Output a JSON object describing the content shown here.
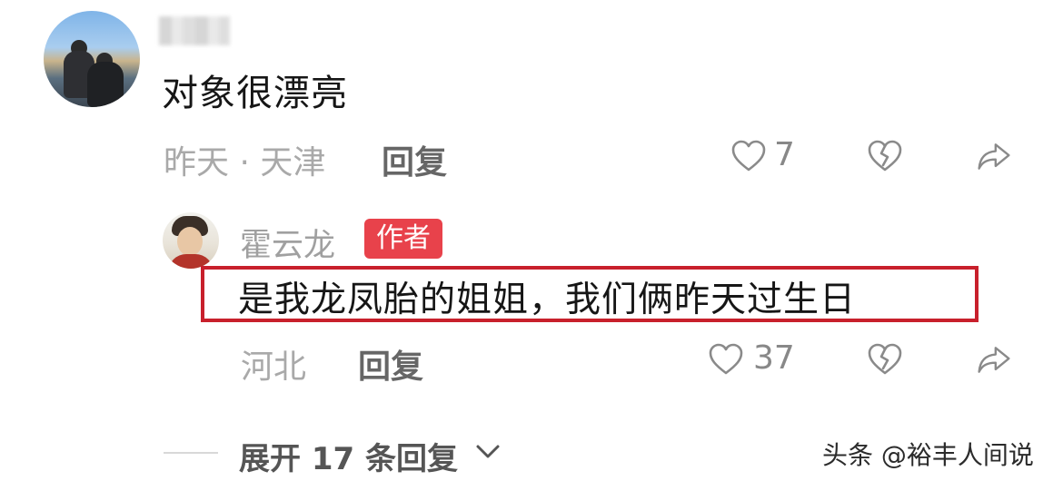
{
  "comment": {
    "author_name_blurred": "",
    "text": "对象很漂亮",
    "meta": "昨天 · 天津",
    "reply_label": "回复",
    "likes": "7"
  },
  "reply": {
    "author_name": "霍云龙",
    "badge": "作者",
    "text": "是我龙凤胎的姐姐，我们俩昨天过生日",
    "meta": "河北",
    "reply_label": "回复",
    "likes": "37"
  },
  "expand_label": "展开 17 条回复",
  "watermark": "头条 @裕丰人间说",
  "icons": {
    "like": "heart-outline-icon",
    "dislike": "broken-heart-icon",
    "share": "share-arrow-icon",
    "expand": "chevron-down-icon"
  },
  "colors": {
    "badge_bg": "#e8424b",
    "highlight_border": "#c8202c",
    "meta_text": "#a9a9a9"
  }
}
